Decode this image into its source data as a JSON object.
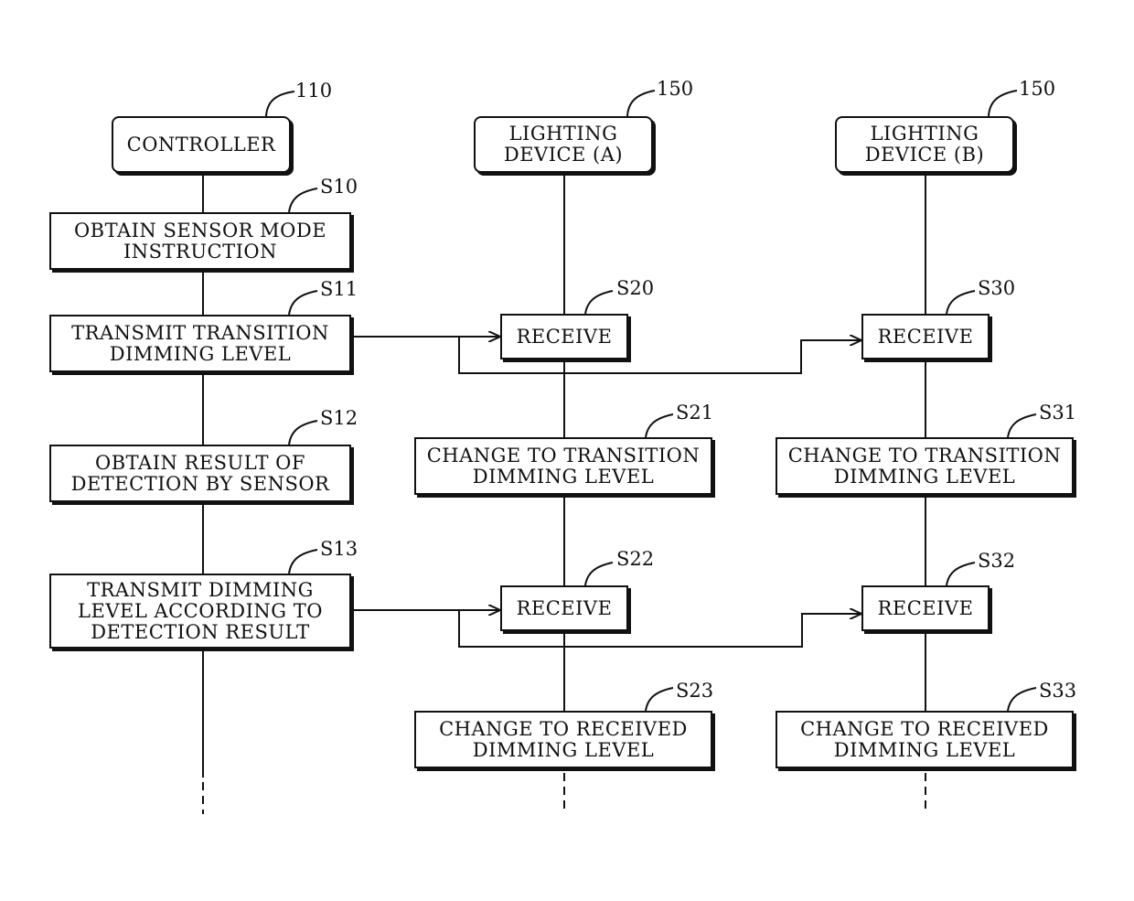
{
  "lanes": [
    {
      "name": "CONTROLLER",
      "ref": "110"
    },
    {
      "name": "LIGHTING\nDEVICE (A)",
      "ref": "150"
    },
    {
      "name": "LIGHTING\nDEVICE (B)",
      "ref": "150"
    }
  ],
  "steps": {
    "S10": {
      "label": "S10",
      "text": "OBTAIN SENSOR MODE\nINSTRUCTION"
    },
    "S11": {
      "label": "S11",
      "text": "TRANSMIT TRANSITION\nDIMMING LEVEL"
    },
    "S12": {
      "label": "S12",
      "text": "OBTAIN RESULT OF\nDETECTION BY SENSOR"
    },
    "S13": {
      "label": "S13",
      "text": "TRANSMIT DIMMING\nLEVEL ACCORDING TO\nDETECTION RESULT"
    },
    "S20": {
      "label": "S20",
      "text": "RECEIVE"
    },
    "S21": {
      "label": "S21",
      "text": "CHANGE TO TRANSITION\nDIMMING LEVEL"
    },
    "S22": {
      "label": "S22",
      "text": "RECEIVE"
    },
    "S23": {
      "label": "S23",
      "text": "CHANGE TO RECEIVED\nDIMMING LEVEL"
    },
    "S30": {
      "label": "S30",
      "text": "RECEIVE"
    },
    "S31": {
      "label": "S31",
      "text": "CHANGE TO TRANSITION\nDIMMING LEVEL"
    },
    "S32": {
      "label": "S32",
      "text": "RECEIVE"
    },
    "S33": {
      "label": "S33",
      "text": "CHANGE TO RECEIVED\nDIMMING LEVEL"
    }
  },
  "messages": [
    {
      "from": "S11",
      "to": [
        "S20",
        "S30"
      ]
    },
    {
      "from": "S13",
      "to": [
        "S22",
        "S32"
      ]
    }
  ]
}
